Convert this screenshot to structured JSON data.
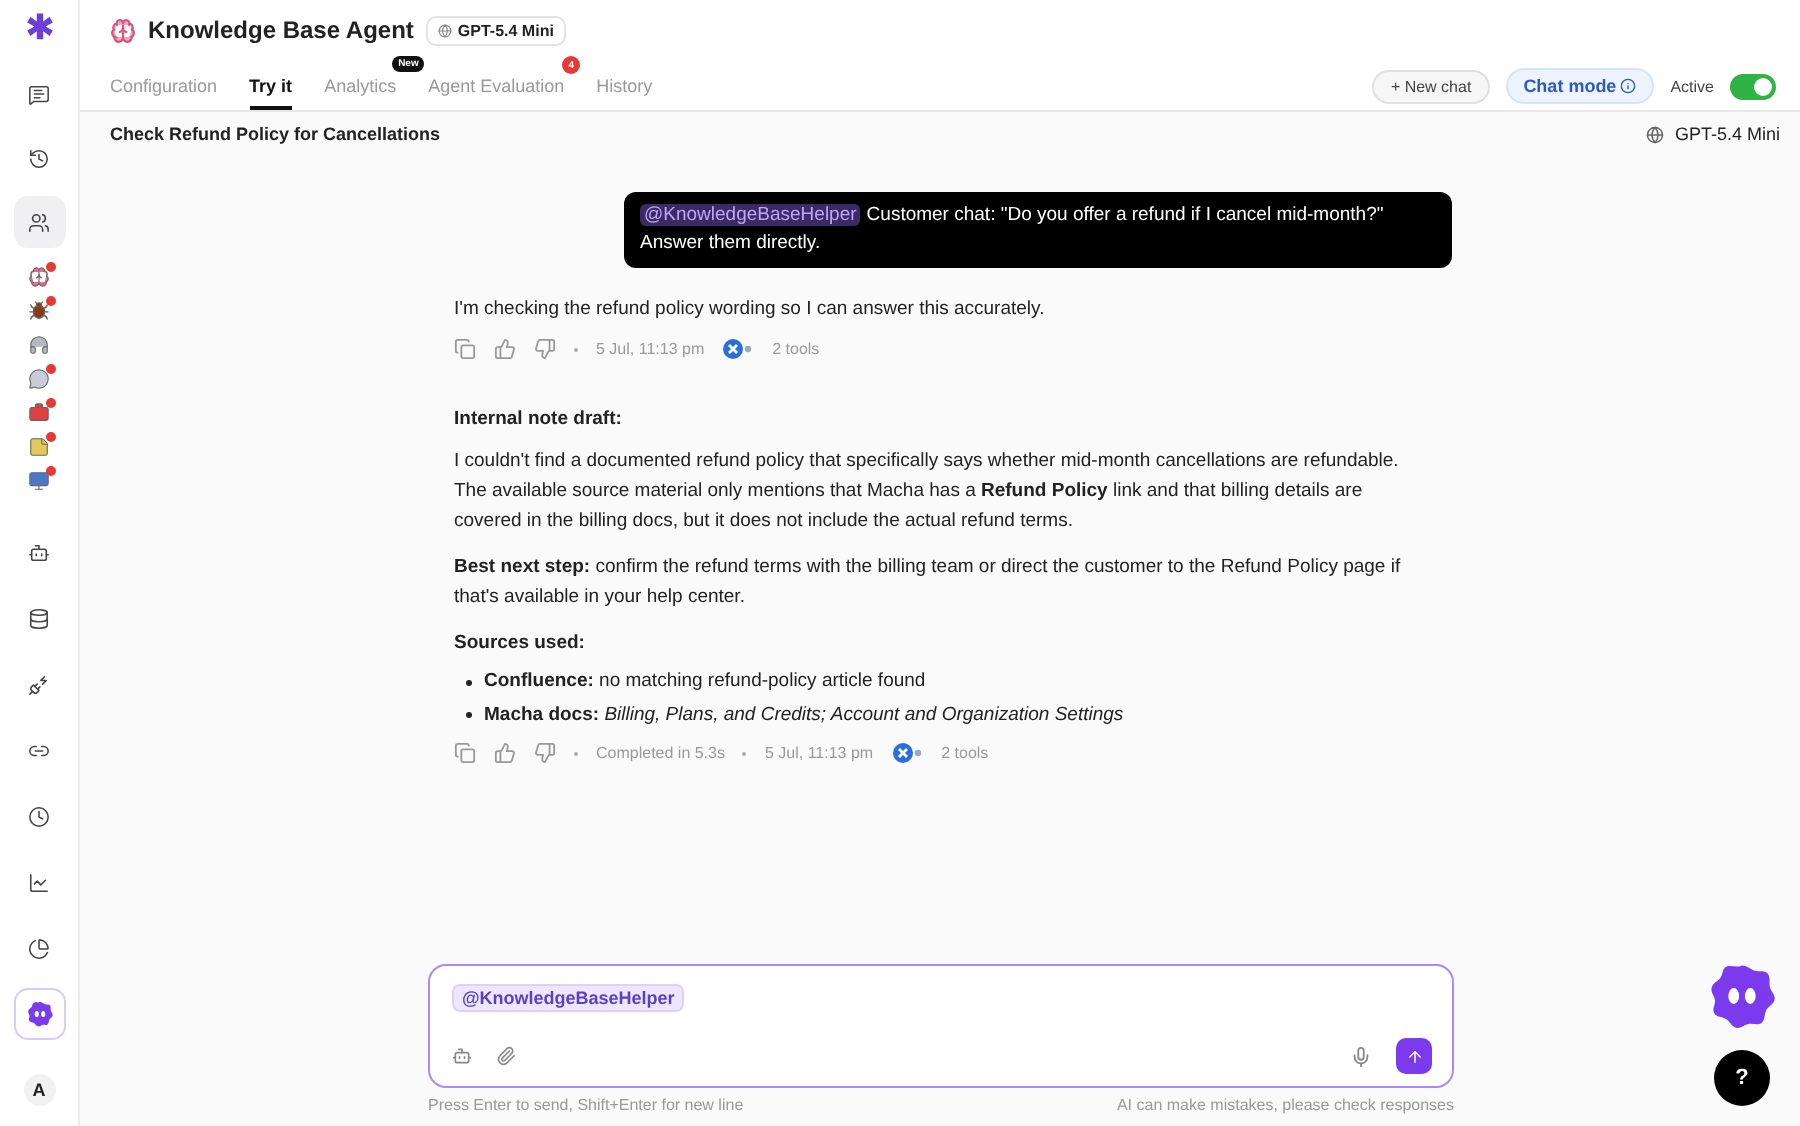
{
  "sidebar": {
    "top_items": [
      {
        "selected": false
      },
      {
        "selected": false
      },
      {
        "selected": true
      }
    ],
    "apps": [
      {
        "color": "#e56b8f",
        "alert": true
      },
      {
        "color": "#8a3b12",
        "alert": true
      },
      {
        "color": "#b8b8c0",
        "alert": false
      },
      {
        "color": "#c9ccd6",
        "alert": true
      },
      {
        "color": "#e04040",
        "alert": true
      },
      {
        "color": "#e3c85a",
        "alert": true
      },
      {
        "color": "#4a78c8",
        "alert": true
      }
    ],
    "bottom_items": [
      {
        "selected": false
      },
      {
        "selected": false
      },
      {
        "selected": false
      },
      {
        "selected": false
      },
      {
        "selected": false
      },
      {
        "selected": false
      },
      {
        "selected": false
      },
      {
        "selected": true
      }
    ],
    "avatar": "A"
  },
  "header": {
    "title": "Knowledge Base Agent",
    "model": "GPT-5.4 Mini",
    "tabs": [
      {
        "label": "Configuration",
        "selected": false
      },
      {
        "label": "Try it",
        "selected": true
      },
      {
        "label": "Analytics",
        "selected": false,
        "badge": "New",
        "kind": "new"
      },
      {
        "label": "Agent Evaluation",
        "selected": false,
        "badge": "4",
        "kind": "count"
      },
      {
        "label": "History",
        "selected": false
      }
    ],
    "new_chat": "+ New chat",
    "chat_mode": "Chat mode",
    "status_label": "Active",
    "status_on": true
  },
  "chat": {
    "title": "Check Refund Policy for Cancellations",
    "model": "GPT-5.4 Mini",
    "user_message": {
      "mention": "@KnowledgeBaseHelper",
      "text": "Customer chat: \"Do you offer a refund if I cancel mid-month?\" Answer them directly."
    },
    "replies": [
      {
        "blocks": [
          {
            "kind": "paragraph",
            "text": "I'm checking the refund policy wording so I can answer this accurately."
          }
        ],
        "time": "5 Jul, 11:13 pm",
        "tools": "2 tools"
      },
      {
        "blocks": [
          {
            "kind": "heading",
            "text": "Internal note draft:"
          },
          {
            "kind": "paragraph",
            "text": "I couldn't find a documented refund policy that specifically says whether mid-month cancellations are refundable. The available source material only mentions that Macha has a **Refund Policy** link and that billing details are covered in the billing docs, but it does not include the actual refund terms."
          },
          {
            "kind": "paragraph",
            "text": "**Best next step:** confirm the refund terms with the billing team or direct the customer to the Refund Policy page if that's available in your help center."
          },
          {
            "kind": "heading",
            "text": "Sources used:"
          },
          {
            "kind": "bullets",
            "items": [
              "**Confluence:** no matching refund-policy article found",
              "**Macha docs:** *Billing, Plans, and Credits; Account and Organization Settings*"
            ]
          }
        ],
        "completed": "Completed in 5.3s",
        "time": "5 Jul, 11:13 pm",
        "tools": "2 tools"
      }
    ]
  },
  "composer": {
    "mention": "@KnowledgeBaseHelper",
    "hint_left": "Press Enter to send, Shift+Enter for new line",
    "hint_right": "AI can make mistakes, please check responses"
  },
  "help_button": "?"
}
